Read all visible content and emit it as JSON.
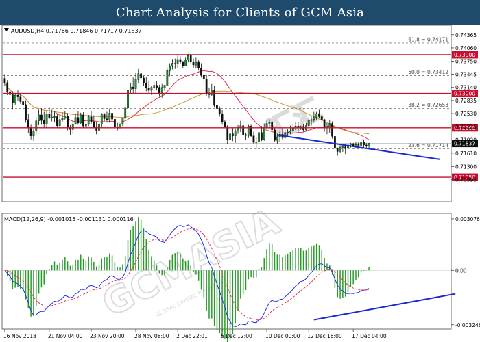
{
  "header": {
    "title": "Chart Analysis for Clients of GCM Asia"
  },
  "chart_data": {
    "type": "candlestick",
    "symbol_info": "AUDUSD,H4  0.71766 0.71846 0.71717 0.71837",
    "price_axis": {
      "min": 0.70478,
      "max": 0.74584,
      "ticks": [
        "0.74365",
        "0.74060",
        "0.73750",
        "0.73445",
        "0.73140",
        "0.72835",
        "0.72530",
        "0.72225",
        "0.71920",
        "0.71610",
        "0.71300",
        "0.70995"
      ]
    },
    "support_resistance": [
      {
        "label": "0.73900",
        "value": 0.739
      },
      {
        "label": "0.73000",
        "value": 0.73
      },
      {
        "label": "0.72200",
        "value": 0.722
      },
      {
        "label": "0.71050",
        "value": 0.7105
      }
    ],
    "fibonacci": [
      {
        "label": "61.8 = 0.74171",
        "value": 0.74171
      },
      {
        "label": "50.0 = 0.73412",
        "value": 0.73412
      },
      {
        "label": "38.2 = 0.72653",
        "value": 0.72653
      },
      {
        "label": "23.6 = 0.71714",
        "value": 0.71714
      }
    ],
    "current_price": {
      "label": "0.71837",
      "value": 0.71837
    },
    "x_labels": [
      "16 Nov 2018",
      "21 Nov 04:00",
      "23 Nov 20:00",
      "28 Nov 08:00",
      "2 Dec 22:01",
      "5 Dec 12:00",
      "10 Dec 00:00",
      "12 Dec 16:00",
      "17 Dec 04:00"
    ],
    "candles": [
      [
        0.7335,
        0.7345,
        0.7318,
        0.7325
      ],
      [
        0.7325,
        0.7331,
        0.7296,
        0.7304
      ],
      [
        0.7304,
        0.7323,
        0.7284,
        0.7297
      ],
      [
        0.7297,
        0.7305,
        0.7262,
        0.7278
      ],
      [
        0.7278,
        0.7299,
        0.7274,
        0.7296
      ],
      [
        0.7296,
        0.7307,
        0.7282,
        0.7292
      ],
      [
        0.7292,
        0.7301,
        0.7276,
        0.7281
      ],
      [
        0.7281,
        0.7288,
        0.7262,
        0.7274
      ],
      [
        0.7274,
        0.7284,
        0.7232,
        0.7239
      ],
      [
        0.7239,
        0.7253,
        0.7208,
        0.7221
      ],
      [
        0.7221,
        0.7227,
        0.7193,
        0.7201
      ],
      [
        0.7201,
        0.7217,
        0.719,
        0.7212
      ],
      [
        0.7212,
        0.7245,
        0.7205,
        0.7236
      ],
      [
        0.7236,
        0.7262,
        0.7226,
        0.725
      ],
      [
        0.725,
        0.7265,
        0.7227,
        0.7237
      ],
      [
        0.7237,
        0.7257,
        0.722,
        0.7228
      ],
      [
        0.7228,
        0.7258,
        0.7219,
        0.7252
      ],
      [
        0.7252,
        0.7268,
        0.724,
        0.7243
      ],
      [
        0.7243,
        0.7262,
        0.7235,
        0.7245
      ],
      [
        0.7245,
        0.7259,
        0.7232,
        0.7246
      ],
      [
        0.7246,
        0.7253,
        0.722,
        0.7225
      ],
      [
        0.7225,
        0.7249,
        0.7217,
        0.7239
      ],
      [
        0.7239,
        0.7256,
        0.7233,
        0.7242
      ],
      [
        0.7242,
        0.7259,
        0.7239,
        0.7247
      ],
      [
        0.7247,
        0.7254,
        0.7214,
        0.7222
      ],
      [
        0.7222,
        0.7226,
        0.7204,
        0.7216
      ],
      [
        0.7216,
        0.7237,
        0.7205,
        0.7228
      ],
      [
        0.7228,
        0.7253,
        0.7227,
        0.7244
      ],
      [
        0.7244,
        0.7259,
        0.7227,
        0.7231
      ],
      [
        0.7231,
        0.7255,
        0.7228,
        0.725
      ],
      [
        0.725,
        0.7256,
        0.7219,
        0.7224
      ],
      [
        0.7224,
        0.724,
        0.7217,
        0.7229
      ],
      [
        0.7229,
        0.725,
        0.7224,
        0.7246
      ],
      [
        0.7246,
        0.7259,
        0.7229,
        0.7234
      ],
      [
        0.7234,
        0.7249,
        0.7219,
        0.7221
      ],
      [
        0.7221,
        0.7233,
        0.7205,
        0.7214
      ],
      [
        0.7214,
        0.7236,
        0.7202,
        0.7229
      ],
      [
        0.7229,
        0.7254,
        0.7221,
        0.7251
      ],
      [
        0.7251,
        0.7254,
        0.7235,
        0.7241
      ],
      [
        0.7241,
        0.7257,
        0.7232,
        0.7238
      ],
      [
        0.7238,
        0.7265,
        0.7232,
        0.7254
      ],
      [
        0.7254,
        0.7265,
        0.7237,
        0.724
      ],
      [
        0.724,
        0.725,
        0.7219,
        0.7222
      ],
      [
        0.7222,
        0.7231,
        0.7214,
        0.7219
      ],
      [
        0.7219,
        0.723,
        0.7219,
        0.7229
      ],
      [
        0.7229,
        0.7243,
        0.7224,
        0.7242
      ],
      [
        0.7242,
        0.7274,
        0.7239,
        0.7266
      ],
      [
        0.7266,
        0.732,
        0.7257,
        0.7308
      ],
      [
        0.7308,
        0.7324,
        0.7298,
        0.7315
      ],
      [
        0.7315,
        0.7337,
        0.7301,
        0.7311
      ],
      [
        0.7311,
        0.7348,
        0.7298,
        0.7332
      ],
      [
        0.7332,
        0.7357,
        0.7323,
        0.7346
      ],
      [
        0.7346,
        0.7356,
        0.733,
        0.7336
      ],
      [
        0.7336,
        0.7341,
        0.7318,
        0.7324
      ],
      [
        0.7324,
        0.7338,
        0.7305,
        0.7313
      ],
      [
        0.7313,
        0.733,
        0.7299,
        0.7307
      ],
      [
        0.7307,
        0.7318,
        0.7296,
        0.7314
      ],
      [
        0.7314,
        0.7326,
        0.7306,
        0.7319
      ],
      [
        0.7319,
        0.7329,
        0.7307,
        0.7314
      ],
      [
        0.7314,
        0.732,
        0.7292,
        0.7301
      ],
      [
        0.7301,
        0.7322,
        0.729,
        0.7314
      ],
      [
        0.7314,
        0.732,
        0.7306,
        0.7319
      ],
      [
        0.7319,
        0.7358,
        0.7319,
        0.7353
      ],
      [
        0.7353,
        0.737,
        0.734,
        0.7363
      ],
      [
        0.7363,
        0.738,
        0.7356,
        0.737
      ],
      [
        0.737,
        0.7381,
        0.7357,
        0.737
      ],
      [
        0.737,
        0.7391,
        0.7359,
        0.7379
      ],
      [
        0.7379,
        0.7386,
        0.7368,
        0.7374
      ],
      [
        0.7374,
        0.7375,
        0.7359,
        0.7364
      ],
      [
        0.7364,
        0.7383,
        0.7364,
        0.7378
      ],
      [
        0.7378,
        0.7392,
        0.7373,
        0.7388
      ],
      [
        0.7388,
        0.7393,
        0.737,
        0.7373
      ],
      [
        0.7373,
        0.7381,
        0.7359,
        0.7366
      ],
      [
        0.7366,
        0.7383,
        0.7358,
        0.7374
      ],
      [
        0.7374,
        0.7379,
        0.7353,
        0.7359
      ],
      [
        0.7359,
        0.737,
        0.7337,
        0.7343
      ],
      [
        0.7343,
        0.7351,
        0.7319,
        0.7334
      ],
      [
        0.7334,
        0.7344,
        0.7295,
        0.7299
      ],
      [
        0.7299,
        0.7312,
        0.7288,
        0.7297
      ],
      [
        0.7297,
        0.7322,
        0.7294,
        0.7308
      ],
      [
        0.7308,
        0.7318,
        0.7267,
        0.7272
      ],
      [
        0.7272,
        0.7282,
        0.725,
        0.7265
      ],
      [
        0.7265,
        0.727,
        0.7246,
        0.7252
      ],
      [
        0.7252,
        0.7261,
        0.7227,
        0.7234
      ],
      [
        0.7234,
        0.7238,
        0.722,
        0.7223
      ],
      [
        0.7223,
        0.7226,
        0.7182,
        0.7192
      ],
      [
        0.7192,
        0.7207,
        0.7179,
        0.7206
      ],
      [
        0.7206,
        0.7219,
        0.7189,
        0.7201
      ],
      [
        0.7201,
        0.7217,
        0.7185,
        0.7213
      ],
      [
        0.7213,
        0.7226,
        0.7206,
        0.7221
      ],
      [
        0.7221,
        0.7236,
        0.721,
        0.7225
      ],
      [
        0.7225,
        0.7237,
        0.7199,
        0.7204
      ],
      [
        0.7204,
        0.7209,
        0.7192,
        0.7202
      ],
      [
        0.7202,
        0.7227,
        0.7196,
        0.7224
      ],
      [
        0.7224,
        0.7227,
        0.7199,
        0.7201
      ],
      [
        0.7201,
        0.7211,
        0.7182,
        0.7186
      ],
      [
        0.7186,
        0.7199,
        0.717,
        0.7187
      ],
      [
        0.7187,
        0.7215,
        0.7185,
        0.7209
      ],
      [
        0.7209,
        0.7224,
        0.7189,
        0.7193
      ],
      [
        0.7193,
        0.723,
        0.719,
        0.7221
      ],
      [
        0.7221,
        0.7236,
        0.7218,
        0.723
      ],
      [
        0.723,
        0.724,
        0.7222,
        0.7232
      ],
      [
        0.7232,
        0.7236,
        0.7211,
        0.7215
      ],
      [
        0.7215,
        0.722,
        0.7188,
        0.7191
      ],
      [
        0.7191,
        0.7206,
        0.7183,
        0.7199
      ],
      [
        0.7199,
        0.7213,
        0.7187,
        0.7205
      ],
      [
        0.7205,
        0.722,
        0.7192,
        0.7197
      ],
      [
        0.7197,
        0.7215,
        0.7195,
        0.7209
      ],
      [
        0.7209,
        0.7217,
        0.7199,
        0.721
      ],
      [
        0.721,
        0.7225,
        0.7205,
        0.7213
      ],
      [
        0.7213,
        0.723,
        0.7206,
        0.7219
      ],
      [
        0.7219,
        0.7233,
        0.7215,
        0.7224
      ],
      [
        0.7224,
        0.7234,
        0.721,
        0.722
      ],
      [
        0.722,
        0.7225,
        0.7215,
        0.7223
      ],
      [
        0.7223,
        0.7229,
        0.7211,
        0.7215
      ],
      [
        0.7215,
        0.7231,
        0.7212,
        0.7225
      ],
      [
        0.7225,
        0.7243,
        0.7222,
        0.7237
      ],
      [
        0.7237,
        0.7246,
        0.7225,
        0.7239
      ],
      [
        0.7239,
        0.7257,
        0.7232,
        0.7244
      ],
      [
        0.7244,
        0.7257,
        0.7239,
        0.7253
      ],
      [
        0.7253,
        0.7262,
        0.7243,
        0.7246
      ],
      [
        0.7246,
        0.7253,
        0.7231,
        0.7239
      ],
      [
        0.7239,
        0.7241,
        0.7211,
        0.7221
      ],
      [
        0.7221,
        0.7231,
        0.7205,
        0.7222
      ],
      [
        0.7222,
        0.7239,
        0.7207,
        0.723
      ],
      [
        0.723,
        0.7235,
        0.7195,
        0.72
      ],
      [
        0.72,
        0.7202,
        0.7164,
        0.7172
      ],
      [
        0.7172,
        0.7174,
        0.7155,
        0.7165
      ],
      [
        0.7165,
        0.7179,
        0.7162,
        0.7175
      ],
      [
        0.7175,
        0.7182,
        0.7164,
        0.7176
      ],
      [
        0.7176,
        0.7182,
        0.7159,
        0.7172
      ],
      [
        0.7172,
        0.7182,
        0.7165,
        0.718
      ],
      [
        0.718,
        0.7185,
        0.7174,
        0.7183
      ],
      [
        0.7183,
        0.7185,
        0.7176,
        0.7177
      ],
      [
        0.7177,
        0.7188,
        0.7173,
        0.7181
      ],
      [
        0.7181,
        0.7186,
        0.7171,
        0.7179
      ],
      [
        0.7179,
        0.7191,
        0.7176,
        0.7187
      ],
      [
        0.7187,
        0.7193,
        0.7174,
        0.718
      ],
      [
        0.718,
        0.7185,
        0.7172,
        0.7177
      ],
      [
        0.7177,
        0.7185,
        0.7172,
        0.7184
      ]
    ],
    "trendlines": [
      {
        "name": "price-support-trendline",
        "color": "#1a2acc",
        "points": [
          [
            104,
            0.72031
          ],
          [
            166,
            0.71468
          ]
        ]
      },
      {
        "name": "macd-trendline",
        "color": "#1a2acc",
        "points": [
          [
            118,
            -0.00295
          ],
          [
            172,
            -0.0014
          ]
        ]
      }
    ],
    "moving_averages": [
      {
        "color": "#e0344a",
        "period": 20
      },
      {
        "color": "#c89a3c",
        "period": 50
      }
    ],
    "macd": {
      "label": "MACD(12,26,9) -0.001015 -0.001131 0.000116",
      "ticks": [
        "0.003076",
        "0.00",
        "-0.003246"
      ],
      "min": -0.0035,
      "max": 0.0034,
      "line_color": "#1f2fe0",
      "signal_color": "#e0344a",
      "hist_color": "#2a9a2a"
    },
    "colors": {
      "bull_body": "#1d9a2c",
      "bear_body": "#0d0d0d",
      "resistance": "#c8102e",
      "fib": "#555555",
      "current_box": "#101010"
    },
    "watermark": {
      "text": "GCMASIA",
      "subtext": "GLOBAL CAPITAL MARKETS",
      "chinese": "汇汇"
    }
  }
}
